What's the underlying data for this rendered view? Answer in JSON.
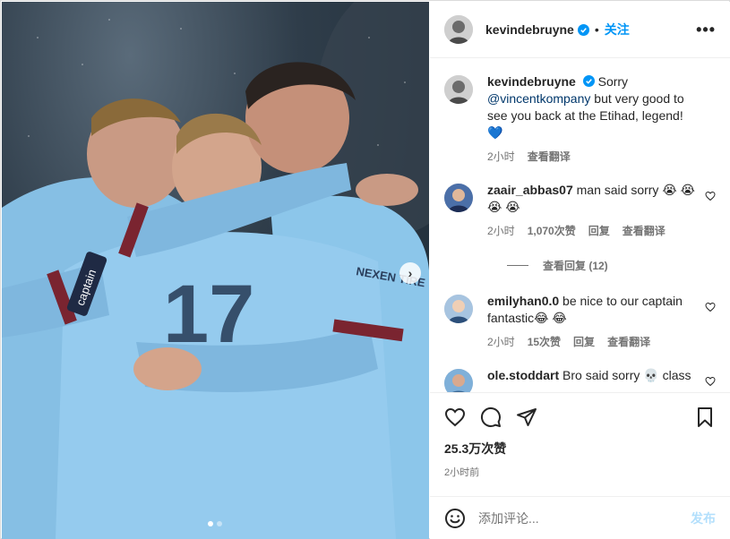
{
  "post": {
    "author": "kevindebruyne",
    "follow_label": "关注",
    "more_label": "•••",
    "caption": {
      "user": "kevindebruyne",
      "text_before": "Sorry",
      "mention": "@vincentkompany",
      "text_after": "but very good to see you back at the Etihad, legend! 💙",
      "time": "2小时",
      "translate": "查看翻译"
    },
    "comments": [
      {
        "user": "zaair_abbas07",
        "text": "man said sorry 😭 😭 😭 😭",
        "time": "2小时",
        "likes": "1,070次赞",
        "reply": "回复",
        "translate": "查看翻译",
        "replies_label": "查看回复 (12)"
      },
      {
        "user": "emilyhan0.0",
        "text": "be nice to our captain fantastic😂 😂",
        "time": "2小时",
        "likes": "15次赞",
        "reply": "回复",
        "translate": "查看翻译"
      },
      {
        "user": "ole.stoddart",
        "text": "Bro said sorry 💀 class"
      }
    ],
    "likes_total": "25.3万次赞",
    "posted_ago": "2小时前",
    "comment_placeholder": "添加评论...",
    "post_label": "发布",
    "image_text": {
      "shirt_number": "17",
      "armband": "captain",
      "sponsor": "NEXEN TIRE"
    }
  },
  "colors": {
    "accent": "#0095f6",
    "post_disabled": "#b2dffc",
    "jersey": "#8fc4e8"
  },
  "icons": [
    "verified-badge-icon",
    "more-options-icon",
    "heart-icon",
    "comment-icon",
    "share-icon",
    "bookmark-icon",
    "emoji-icon",
    "next-image-icon"
  ]
}
